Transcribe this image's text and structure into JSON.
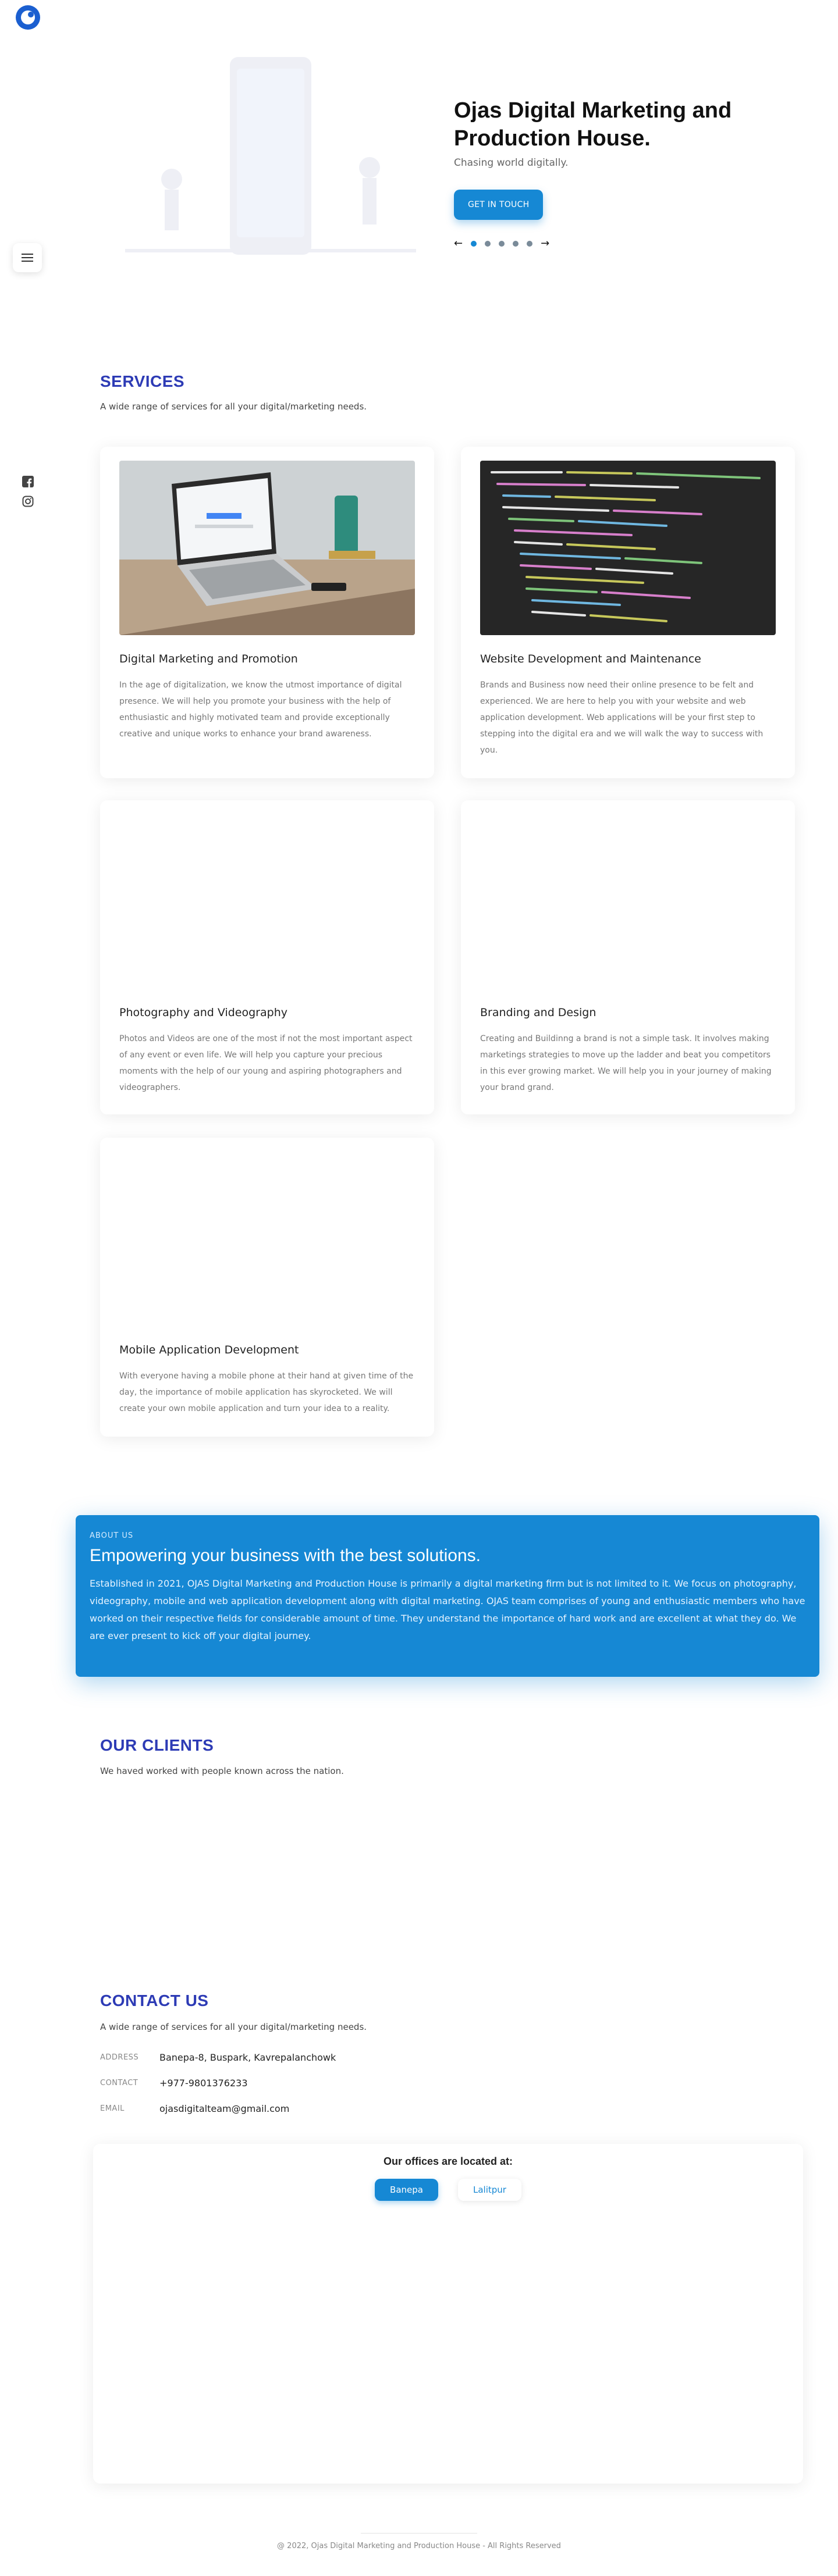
{
  "brand": {
    "logo_text": "OJAS",
    "accent": "#1688d4",
    "heading_color": "#2d3bb5"
  },
  "nav": {
    "menu_icon": "hamburger-icon"
  },
  "socials": [
    {
      "icon": "facebook-icon"
    },
    {
      "icon": "instagram-icon"
    }
  ],
  "hero": {
    "title": "Ojas Digital Marketing and Production House.",
    "subtitle": "Chasing world digitally.",
    "cta_label": "GET IN TOUCH",
    "slides": 5,
    "active_slide": 1
  },
  "services": {
    "title": "SERVICES",
    "subtitle": "A wide range of services for all your digital/marketing needs.",
    "items": [
      {
        "title": "Digital Marketing and Promotion",
        "desc": "In the age of digitalization, we know the utmost importance of digital presence. We will help you promote your business with the help of enthusiastic and highly motivated team and provide exceptionally creative and unique works to enhance your brand awareness.",
        "image": "laptop-photo"
      },
      {
        "title": "Website Development and Maintenance",
        "desc": "Brands and Business now need their online presence to be felt and experienced. We are here to help you with your website and web application development. Web applications will be your first step to stepping into the digital era and we will walk the way to success with you.",
        "image": "code-screen-photo"
      },
      {
        "title": "Photography and Videography",
        "desc": "Photos and Videos are one of the most if not the most important aspect of any event or even life. We will help you capture your precious moments with the help of our young and aspiring photographers and videographers.",
        "image": ""
      },
      {
        "title": "Branding and Design",
        "desc": "Creating and Buildinng a brand is not a simple task. It involves making marketings strategies to move up the ladder and beat you competitors in this ever growing market. We will help you in your journey of making your brand grand.",
        "image": ""
      },
      {
        "title": "Mobile Application Development",
        "desc": "With everyone having a mobile phone at their hand at given time of the day, the importance of mobile application has skyrocketed. We will create your own mobile application and turn your idea to a reality.",
        "image": ""
      }
    ]
  },
  "about": {
    "label": "ABOUT US",
    "title": "Empowering your business with the best solutions.",
    "body": "Established in 2021, OJAS Digital Marketing and Production House is primarily a digital marketing firm but is not limited to it. We focus on photography, videography, mobile and web application development along with digital marketing. OJAS team comprises of young and enthusiastic members who have worked on their respective fields for considerable amount of time. They understand the importance of hard work and are excellent at what they do. We are ever present to kick off your digital journey."
  },
  "clients": {
    "title": "OUR CLIENTS",
    "subtitle": "We haved worked with people known across the nation."
  },
  "contact": {
    "title": "CONTACT US",
    "subtitle": "A wide range of services for all your digital/marketing needs.",
    "rows": [
      {
        "key": "ADDRESS",
        "value": "Banepa-8, Buspark, Kavrepalanchowk"
      },
      {
        "key": "CONTACT",
        "value": "+977-9801376233"
      },
      {
        "key": "EMAIL",
        "value": "ojasdigitalteam@gmail.com"
      }
    ],
    "offices_title": "Our offices are located at:",
    "office_tabs": [
      {
        "label": "Banepa",
        "active": true
      },
      {
        "label": "Lalitpur",
        "active": false
      }
    ]
  },
  "footer": {
    "text": "@ 2022, Ojas Digital Marketing and Production House - All Rights Reserved"
  }
}
